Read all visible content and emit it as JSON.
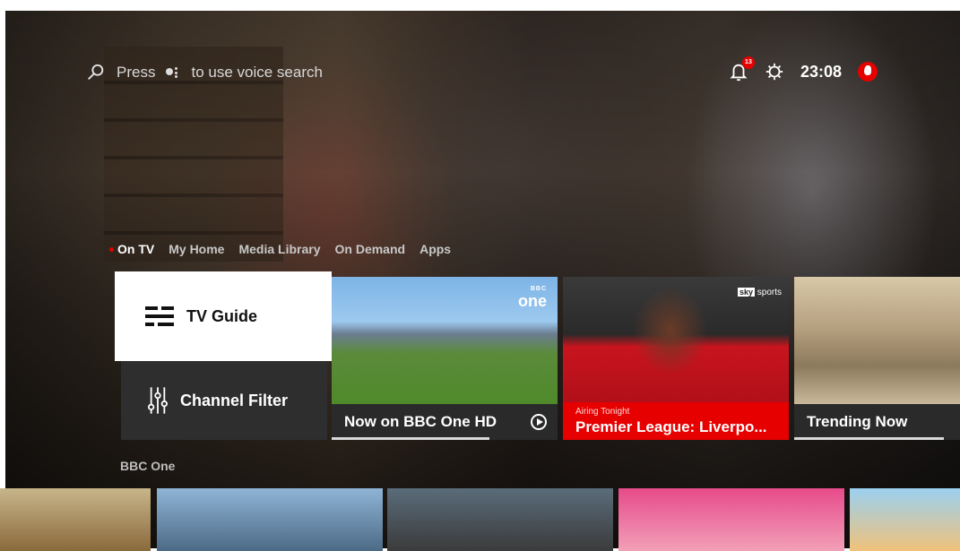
{
  "search": {
    "placeholder_prefix": "Press",
    "placeholder_suffix": "to use voice search"
  },
  "status": {
    "notifications_count": "13",
    "time": "23:08"
  },
  "tabs": [
    {
      "label": "On TV",
      "active": true
    },
    {
      "label": "My Home"
    },
    {
      "label": "Media Library"
    },
    {
      "label": "On Demand"
    },
    {
      "label": "Apps"
    }
  ],
  "menu": {
    "tv_guide": "TV Guide",
    "channel_filter": "Channel Filter"
  },
  "cards": [
    {
      "title": "Now on BBC One HD",
      "logo_top": "BBC",
      "logo_main": "one",
      "progress": 0.7
    },
    {
      "kicker": "Airing Tonight",
      "title": "Premier League: Liverpo...",
      "logo": "sports",
      "logo_mark": "sky"
    },
    {
      "title": "Trending Now",
      "progress": 0.95
    }
  ],
  "section": {
    "label": "BBC One"
  },
  "colors": {
    "accent": "#e60000"
  }
}
